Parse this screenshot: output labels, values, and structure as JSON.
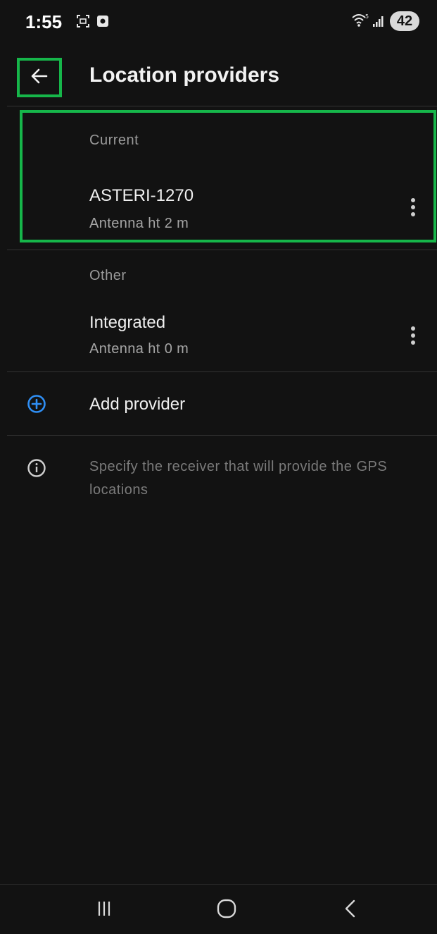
{
  "status_bar": {
    "time": "1:55",
    "battery": "42",
    "icons": [
      "screenshot-icon",
      "media-icon",
      "wifi-icon",
      "signal-icon",
      "battery-icon"
    ]
  },
  "header": {
    "title": "Location providers",
    "back_icon": "arrow-left-icon"
  },
  "providers": {
    "current_label": "Current",
    "current": {
      "name": "ASTERI-1270",
      "detail": "Antenna ht 2 m"
    },
    "other_label": "Other",
    "other": [
      {
        "name": "Integrated",
        "detail": "Antenna ht 0 m"
      }
    ]
  },
  "add_provider": {
    "label": "Add provider",
    "icon": "plus-circle-icon"
  },
  "info": {
    "text": "Specify the receiver that will provide the GPS locations",
    "icon": "info-icon"
  },
  "nav_bar": {
    "buttons": [
      "recents-icon",
      "home-icon",
      "back-icon"
    ]
  },
  "colors": {
    "background": "#121212",
    "accent": "#2f8ff5",
    "highlight": "#16b64a"
  }
}
